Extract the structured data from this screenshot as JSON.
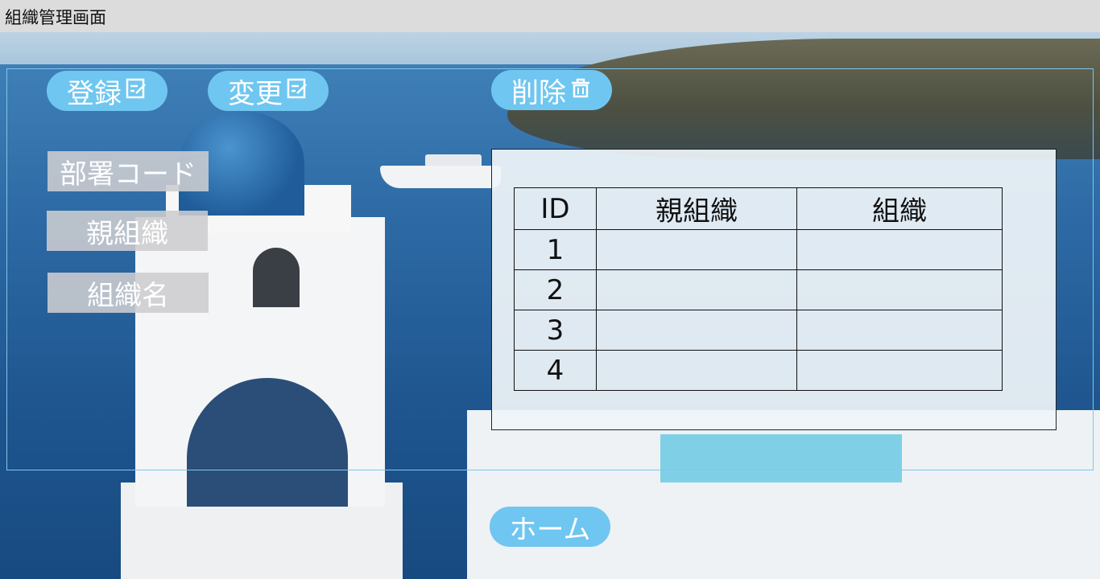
{
  "window": {
    "title": "組織管理画面"
  },
  "toolbar": {
    "register_label": "登録",
    "change_label": "変更",
    "delete_label": "削除"
  },
  "form": {
    "dept_code_label": "部署コード",
    "parent_org_label": "親組織",
    "org_name_label": "組織名"
  },
  "table": {
    "headers": [
      "ID",
      "親組織",
      "組織"
    ],
    "rows": [
      {
        "id": "1",
        "parent": "",
        "org": ""
      },
      {
        "id": "2",
        "parent": "",
        "org": ""
      },
      {
        "id": "3",
        "parent": "",
        "org": ""
      },
      {
        "id": "4",
        "parent": "",
        "org": ""
      }
    ]
  },
  "footer": {
    "home_label": "ホーム"
  },
  "colors": {
    "button": "#6fc6f0",
    "titlebar": "#dcdcdc",
    "label_box": "#cdcdd0"
  },
  "icons": {
    "edit": "edit-icon",
    "trash": "trash-icon"
  }
}
